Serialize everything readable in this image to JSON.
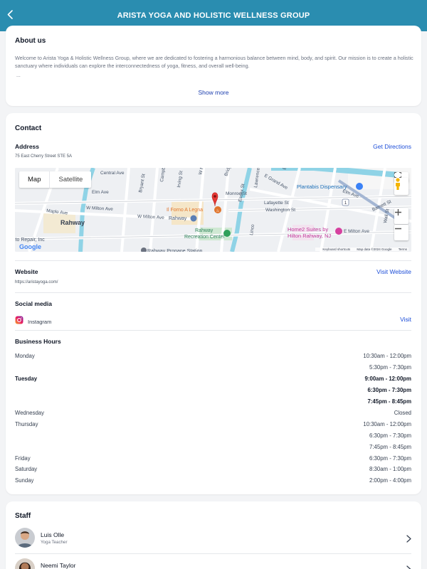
{
  "header": {
    "title": "ARISTA YOGA AND HOLISTIC WELLNESS GROUP"
  },
  "about": {
    "title": "About us",
    "body": "Welcome to Arista Yoga & Holistic Wellness Group, where we are dedicated to fostering a harmonious balance between mind, body, and spirit. Our mission is to create a holistic sanctuary where individuals can explore the interconnectedness of yoga, fitness, and overall well-being.",
    "ellipsis": "...",
    "show_more": "Show more"
  },
  "contact": {
    "title": "Contact",
    "address_label": "Address",
    "address": "75 East Cherry Street STE 5A",
    "directions": "Get Directions",
    "map": {
      "map_tab": "Map",
      "satellite_tab": "Satellite",
      "streets": [
        "Central Ave",
        "Elm Ave",
        "Maple Ave",
        "W Milton Ave",
        "W Milton Ave",
        "Rahway",
        "Bryant St",
        "Campbell St",
        "Irving St",
        "W Main St",
        "Bridge",
        "E Grand Ave",
        "Monroe St",
        "Essex St",
        "Lawrence St",
        "Lafayette St",
        "Washington St",
        "Linco",
        "Elm Ave",
        "Seminary",
        "Dock St",
        "Hamilton St",
        "Barnett St",
        "Wall St",
        "E Milton Ave",
        "Bond St"
      ],
      "pois": {
        "restaurant": "Il Forno A Legna",
        "station": "Rahway",
        "recreation": "Rahway Recreation Center",
        "dispensary": "Plantabis Dispensary",
        "hotel": "Home2 Suites by Hilton Rahway, NJ",
        "repair": "Auto Repair, Inc",
        "propane": "Rahway Propane Station",
        "route": "1"
      },
      "google": "Google",
      "shortcuts": "Keyboard shortcuts",
      "map_data": "Map data ©2024 Google",
      "terms": "Terms"
    },
    "website_label": "Website",
    "website_url": "https://aristayoga.com/",
    "visit_website": "Visit Website",
    "social_label": "Social media",
    "instagram": "Instagram",
    "visit": "Visit",
    "hours_label": "Business Hours",
    "hours": [
      {
        "day": "Monday",
        "time": "10:30am - 12:00pm"
      },
      {
        "day": "",
        "time": "5:30pm - 7:30pm"
      },
      {
        "day": "Tuesday",
        "time": "9:00am - 12:00pm"
      },
      {
        "day": "",
        "time": "6:30pm - 7:30pm"
      },
      {
        "day": "",
        "time": "7:45pm - 8:45pm"
      },
      {
        "day": "Wednesday",
        "time": "Closed"
      },
      {
        "day": "Thursday",
        "time": "10:30am - 12:00pm"
      },
      {
        "day": "",
        "time": "6:30pm - 7:30pm"
      },
      {
        "day": "",
        "time": "7:45pm - 8:45pm"
      },
      {
        "day": "Friday",
        "time": "6:30pm - 7:30pm"
      },
      {
        "day": "Saturday",
        "time": "8:30am - 1:00pm"
      },
      {
        "day": "Sunday",
        "time": "2:00pm - 4:00pm"
      }
    ]
  },
  "staff": {
    "title": "Staff",
    "members": [
      {
        "name": "Luis Olle",
        "role": "Yoga Teacher"
      },
      {
        "name": "Neemi Taylor",
        "role": ""
      }
    ]
  },
  "colors": {
    "header": "#2a8db0",
    "link": "#1d4ed8",
    "pin": "#e53935"
  }
}
